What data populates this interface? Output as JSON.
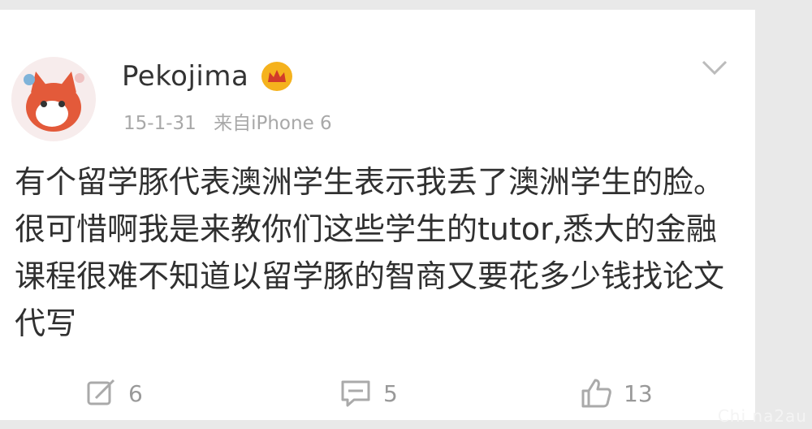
{
  "post": {
    "username": "Pekojima",
    "date": "15-1-31",
    "source": "来自iPhone 6",
    "text": "有个留学豚代表澳洲学生表示我丢了澳洲学生的脸。很可惜啊我是来教你们这些学生的tutor,悉大的金融课程很难不知道以留学豚的智商又要花多少钱找论文代写"
  },
  "actions": {
    "repost_count": "6",
    "comment_count": "5",
    "like_count": "13"
  },
  "watermark": "Chi na2au",
  "colors": {
    "badge": "#f5b21d",
    "meta_text": "#a8a8a8",
    "body_text": "#303030"
  },
  "icons": {
    "avatar": "cartoon-cat-avatar",
    "badge": "crown-badge-icon",
    "menu": "chevron-down-icon",
    "repost": "repost-icon",
    "comment": "comment-icon",
    "like": "thumbs-up-icon"
  }
}
